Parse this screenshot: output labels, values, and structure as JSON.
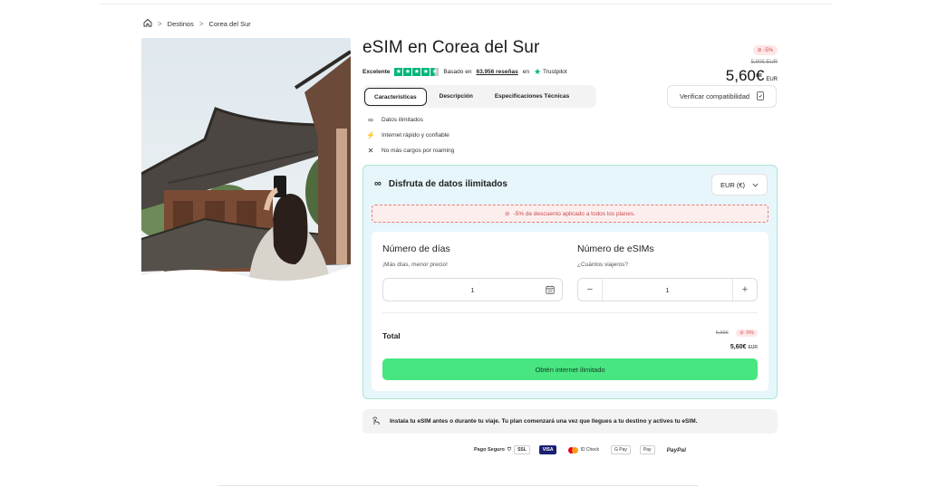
{
  "breadcrumb": {
    "items": [
      "Destinos",
      "Corea del Sur"
    ],
    "separator": ">"
  },
  "product": {
    "title": "eSIM en Corea del Sur",
    "rating_label": "Excelente",
    "reviews_prefix": "Basado en",
    "reviews_count": "63.956 reseñas",
    "reviews_suffix": "en",
    "trustpilot": "Trustpilot",
    "discount_badge": "-5%",
    "old_price": "5,90€ EUR",
    "price": "5,60€",
    "price_currency": "EUR"
  },
  "tabs": [
    {
      "label": "Características",
      "active": true
    },
    {
      "label": "Descripción",
      "active": false
    },
    {
      "label": "Especificaciones Técnicas",
      "active": false
    }
  ],
  "compat_button": "Verificar compatibilidad",
  "features": [
    {
      "icon": "infinity-icon",
      "glyph": "∞",
      "label": "Datos ilimitados"
    },
    {
      "icon": "bolt-icon",
      "glyph": "⚡",
      "label": "Internet rápido y confiable"
    },
    {
      "icon": "no-roaming-icon",
      "glyph": "✕",
      "label": "No más cargos por roaming"
    }
  ],
  "plan": {
    "heading": "Disfruta de datos ilimitados",
    "currency": "EUR (€)",
    "discount_notice": "-5% de descuento aplicado a todos los planes.",
    "days_title": "Número de días",
    "days_subtitle": "¡Más días, menor precio!",
    "days_value": "1",
    "esims_title": "Número de eSIMs",
    "esims_subtitle": "¿Cuántos viajeros?",
    "esims_value": "1",
    "minus": "−",
    "plus": "+",
    "total_label": "Total",
    "total_old": "5,90€",
    "total_badge": "-5%",
    "total_new": "5,60€",
    "total_currency": "EUR",
    "cta": "Obtén internet ilimitado"
  },
  "install_note": "Instala tu eSIM antes o durante tu viaje. Tu plan comenzará una vez que llegues a tu destino y actives tu eSIM.",
  "payments": {
    "secure_label": "Pago Seguro",
    "ssl": "SSL",
    "methods": [
      "VISA",
      "ID Check",
      "G Pay",
      "Pay",
      "PayPal"
    ]
  },
  "colors": {
    "accent_green": "#47e680",
    "panel_bg": "#e7f6fb",
    "panel_border": "#a8e6d6",
    "discount_red": "#d84a4a",
    "trustpilot_green": "#00b67a"
  }
}
